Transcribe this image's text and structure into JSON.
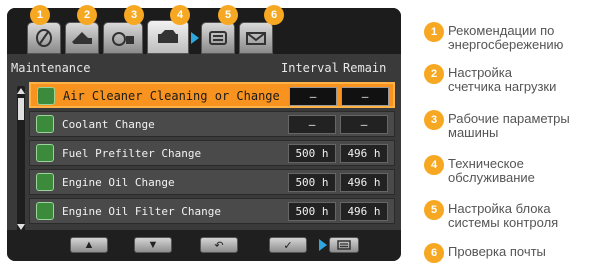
{
  "tabs": [
    {
      "num": "1",
      "icon": "leaf-icon"
    },
    {
      "num": "2",
      "icon": "load-counter-icon"
    },
    {
      "num": "3",
      "icon": "engine-gauge-icon"
    },
    {
      "num": "4",
      "icon": "maintenance-icon",
      "active": true
    },
    {
      "num": "5",
      "icon": "controller-icon"
    },
    {
      "num": "6",
      "icon": "mail-icon"
    }
  ],
  "table": {
    "header": {
      "title": "Maintenance",
      "interval": "Interval",
      "remain": "Remain"
    },
    "rows": [
      {
        "label": "Air Cleaner Cleaning or Change",
        "interval": "—",
        "remain": "—",
        "selected": true
      },
      {
        "label": "Coolant Change",
        "interval": "—",
        "remain": "—"
      },
      {
        "label": "Fuel Prefilter Change",
        "interval": "500 h",
        "remain": "496 h"
      },
      {
        "label": "Engine Oil Change",
        "interval": "500 h",
        "remain": "496 h"
      },
      {
        "label": "Engine Oil Filter Change",
        "interval": "500 h",
        "remain": "496 h"
      }
    ]
  },
  "footer": {
    "up": "▲",
    "down": "▼",
    "back": "↶",
    "ok": "✓"
  },
  "legend": [
    {
      "num": "1",
      "text": "Рекомендации по энергосбережению"
    },
    {
      "num": "2",
      "text": "Настройка счетчика нагрузки"
    },
    {
      "num": "3",
      "text": "Рабочие параметры машины"
    },
    {
      "num": "4",
      "text": "Техническое обслуживание"
    },
    {
      "num": "5",
      "text": "Настройка блока системы контроля"
    },
    {
      "num": "6",
      "text": "Проверка почты"
    }
  ],
  "colors": {
    "accent": "#f7931e",
    "badge": "#f7a823",
    "arrow": "#2ea7e0"
  }
}
